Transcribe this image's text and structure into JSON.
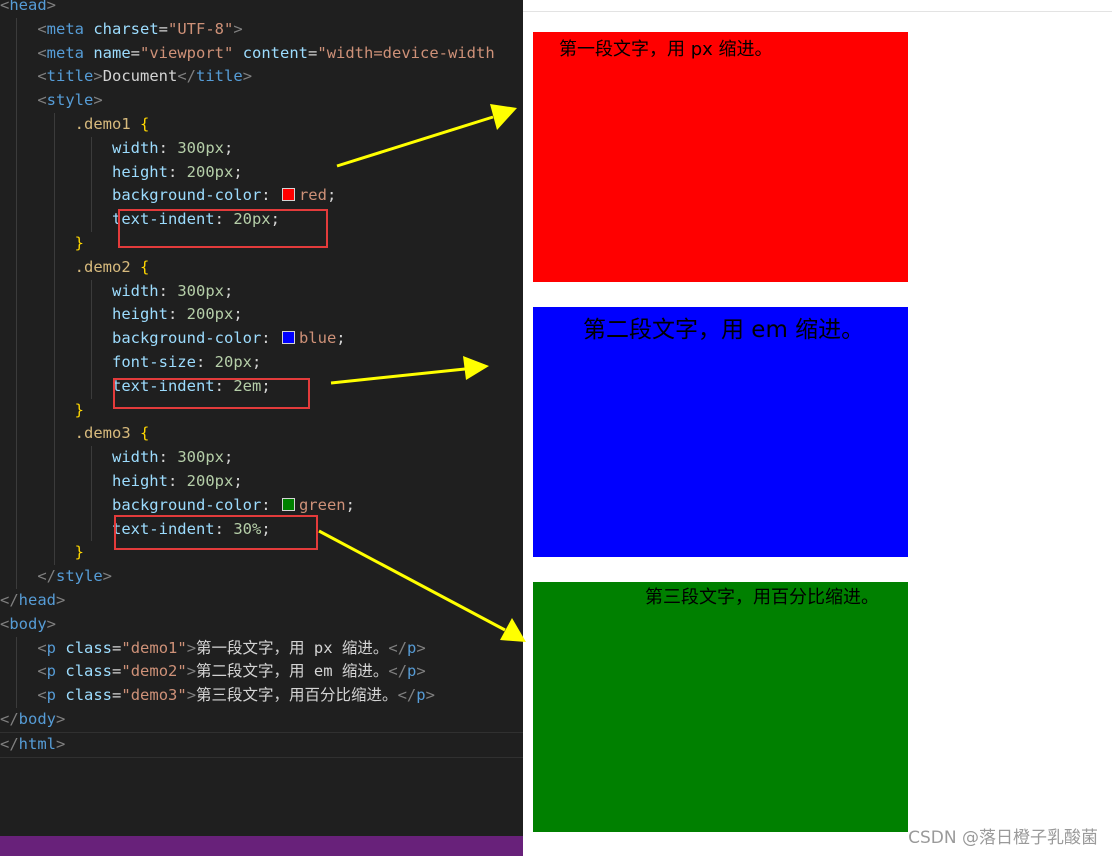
{
  "editor": {
    "lines": [
      "<head>",
      "    <meta charset=\"UTF-8\">",
      "    <meta name=\"viewport\" content=\"width=device-width",
      "    <title>Document</title>",
      "    <style>",
      "        .demo1 {",
      "            width: 300px;",
      "            height: 200px;",
      "            background-color: red;",
      "            text-indent: 20px;",
      "        }",
      "        .demo2 {",
      "            width: 300px;",
      "            height: 200px;",
      "            background-color: blue;",
      "            font-size: 20px;",
      "            text-indent: 2em;",
      "        }",
      "        .demo3 {",
      "            width: 300px;",
      "            height: 200px;",
      "            background-color: green;",
      "            text-indent: 30%;",
      "        }",
      "    </style>",
      "</head>",
      "<body>",
      "    <p class=\"demo1\">第一段文字，用 px 缩进。</p>",
      "    <p class=\"demo2\">第二段文字，用 em 缩进。</p>",
      "    <p class=\"demo3\">第三段文字，用百分比缩进。</p>",
      "</body>",
      "</html>"
    ],
    "swatches": {
      "red": "#ff0000",
      "blue": "#0000ff",
      "green": "#008000"
    }
  },
  "preview": {
    "demo1_text": "第一段文字，用 px 缩进。",
    "demo2_text": "第二段文字，用 em 缩进。",
    "demo3_text": "第三段文字，用百分比缩进。"
  },
  "watermark": "CSDN @落日橙子乳酸菌",
  "colors": {
    "editor_bg": "#1f1f1f",
    "highlight_border": "#e33b3b",
    "arrow": "#ffff00",
    "status_bar": "#68217a"
  }
}
